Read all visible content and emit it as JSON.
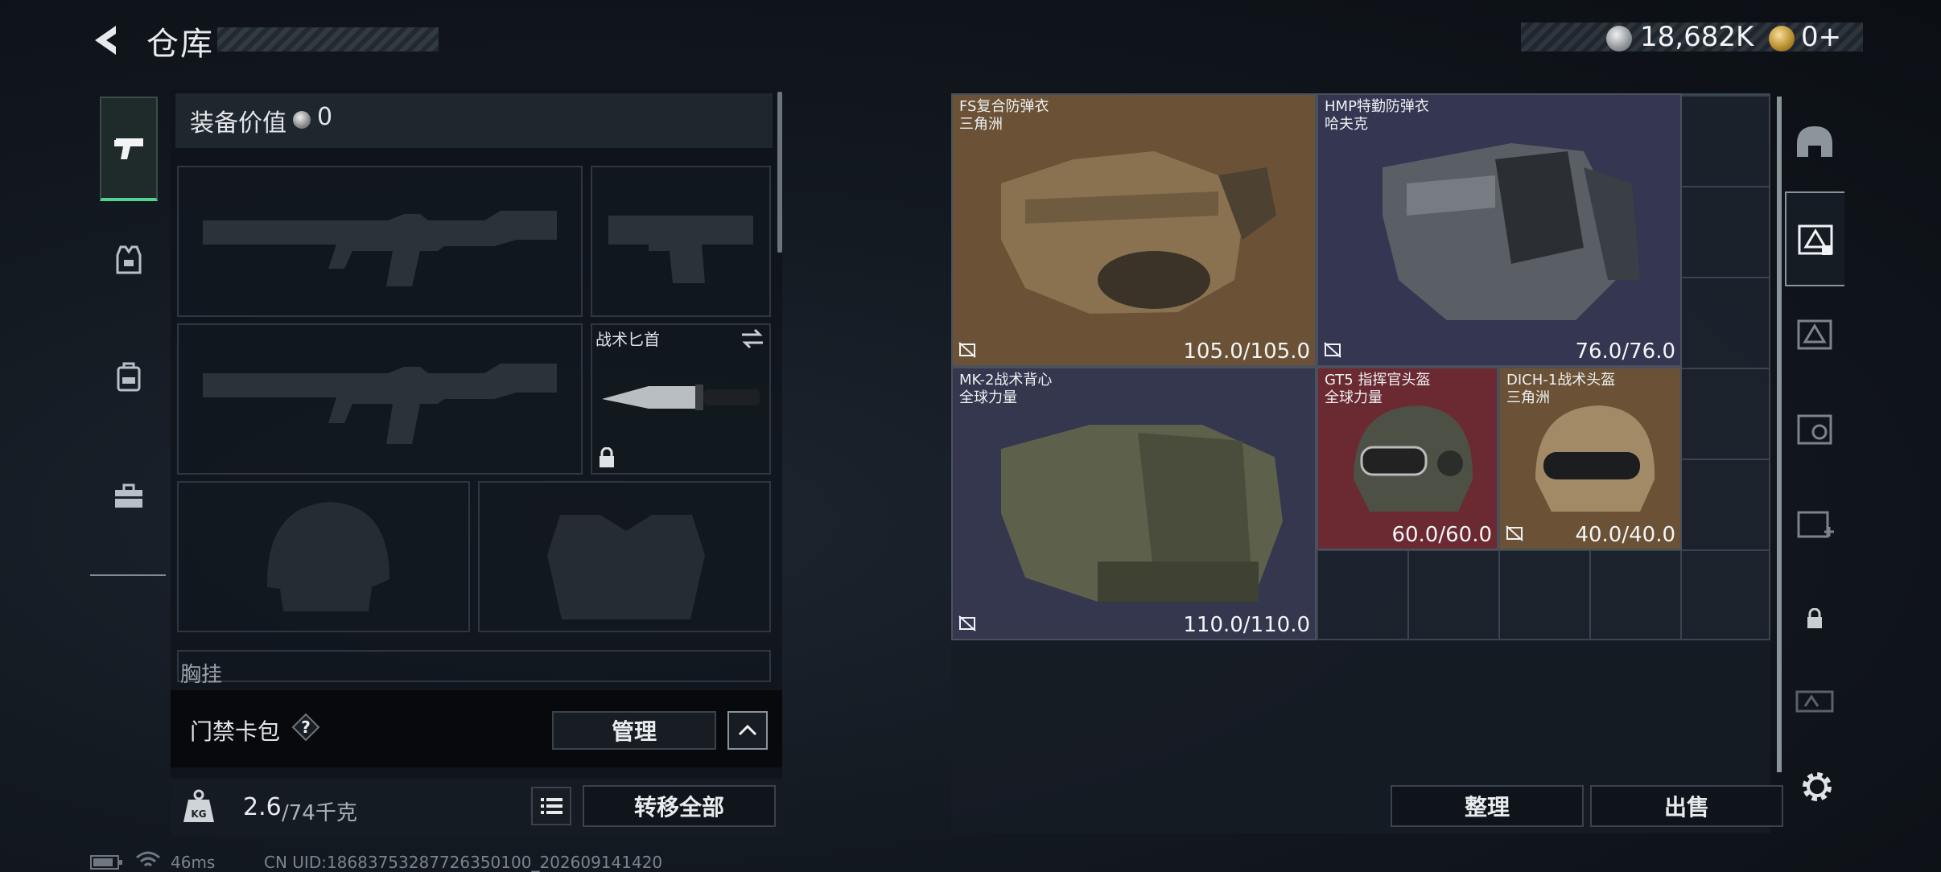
{
  "header": {
    "title": "仓库"
  },
  "currency": {
    "silver": "18,682K",
    "gold": "0+"
  },
  "nav": {
    "items": [
      {
        "name": "weapons",
        "active": true
      },
      {
        "name": "armor",
        "active": false
      },
      {
        "name": "backpack",
        "active": false
      },
      {
        "name": "toolkit",
        "active": false
      }
    ]
  },
  "loadout": {
    "equip_value_label": "装备价值",
    "equip_value": "0",
    "knife_label": "战术匕首",
    "chest_rig_label": "胸挂",
    "keycard_label": "门禁卡包",
    "help_glyph": "?",
    "manage_label": "管理",
    "weight_current": "2.6",
    "weight_max": "/74千克",
    "weight_unit_icon": "KG",
    "transfer_all_label": "转移全部"
  },
  "stash": {
    "items": [
      {
        "name": "FS复合防弹衣",
        "source": "三角洲",
        "durability": "105.0/105.0",
        "tint": "#6b5236"
      },
      {
        "name": "HMP特勤防弹衣",
        "source": "哈夫克",
        "durability": "76.0/76.0",
        "tint": "#343652"
      },
      {
        "name": "MK-2战术背心",
        "source": "全球力量",
        "durability": "110.0/110.0",
        "tint": "#34374e"
      },
      {
        "name": "GT5 指挥官头盔",
        "source": "全球力量",
        "durability": "60.0/60.0",
        "tint": "#6b2a32"
      },
      {
        "name": "DICH-1战术头盔",
        "source": "三角洲",
        "durability": "40.0/40.0",
        "tint": "#6b5236"
      }
    ],
    "tidy_label": "整理",
    "sell_label": "出售"
  },
  "right_tabs": [
    "helmet-icon",
    "stash-page-1-icon",
    "stash-page-2-icon",
    "stash-page-4-icon",
    "stash-page-3-icon",
    "lock-icon",
    "extension-icon"
  ],
  "status_bar": {
    "ping": "46ms",
    "uid": "CN UID:18683753287726350100_202609141420"
  }
}
